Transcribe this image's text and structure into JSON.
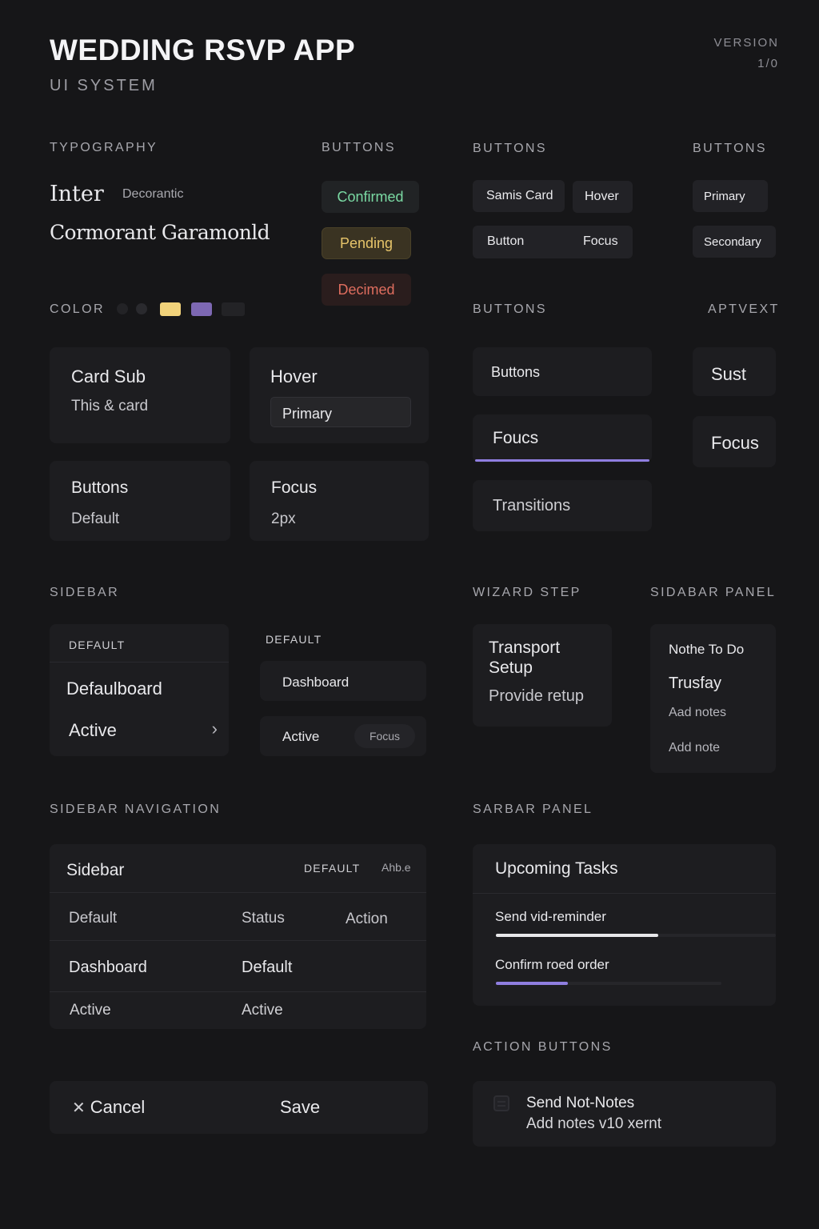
{
  "header": {
    "title": "WEDDING RSVP APP",
    "subtitle": "UI SYSTEM",
    "version_label": "VERSION",
    "version_value": "1/0"
  },
  "typography": {
    "label": "TYPOGRAPHY",
    "primary_font": "Inter",
    "primary_note": "Decorantic",
    "secondary_font": "Cormorant Garamonld"
  },
  "status_buttons": {
    "label": "BUTTONS",
    "confirmed": "Confirmed",
    "pending": "Pending",
    "declined": "Decimed",
    "colors": {
      "confirmed": "#7ad9a3",
      "pending": "#e6c46a",
      "declined": "#de6d5e"
    }
  },
  "button_chips": {
    "label": "BUTTONS",
    "samis_card": "Samis Card",
    "hover": "Hover",
    "button": "Button",
    "focus": "Focus"
  },
  "button_types": {
    "label": "BUTTONS",
    "primary": "Primary",
    "secondary": "Secondary"
  },
  "color": {
    "label": "COLOR",
    "swatches": [
      "#232326",
      "#2a2a2e",
      "#f1d27a",
      "#7d68b3",
      "#232326"
    ]
  },
  "cards": {
    "card_sub_title": "Card Sub",
    "card_sub_text": "This & card",
    "hover_title": "Hover",
    "primary_input": "Primary",
    "buttons_title": "Buttons",
    "buttons_text": "Default",
    "focus_title": "Focus",
    "focus_text": "2px"
  },
  "buttons_states": {
    "label": "BUTTONS",
    "buttons": "Buttons",
    "focus": "Foucs",
    "transitions": "Transitions",
    "focus_underline_color": "#8f7ee0"
  },
  "alt_text": {
    "label": "APTVEXT",
    "sust": "Sust",
    "focus": "Focus"
  },
  "sidebar": {
    "label": "SIDEBAR",
    "left": {
      "header": "DEFAULT",
      "item1": "Defaulboard",
      "item2": "Active"
    },
    "right": {
      "header": "DEFAULT",
      "item1": "Dashboard",
      "item2": "Active",
      "badge": "Focus"
    }
  },
  "wizard": {
    "label": "WIZARD STEP",
    "title": "Transport Setup",
    "text": "Provide retup"
  },
  "sidebar_panel": {
    "label": "SIDABAR PANEL",
    "title": "Nothe To Do",
    "item": "Trusfay",
    "note1": "Aad notes",
    "note2": "Add note"
  },
  "sidebar_nav": {
    "label": "SIDEBAR NAVIGATION",
    "title": "Sidebar",
    "header_tag": "DEFAULT",
    "header_extra": "Ahb.e",
    "columns": [
      "Default",
      "Status",
      "Action"
    ],
    "rows": [
      [
        "Dashboard",
        "Default"
      ],
      [
        "Active",
        "Active"
      ]
    ]
  },
  "tasks_panel": {
    "label": "SARBAR PANEL",
    "title": "Upcoming Tasks",
    "tasks": [
      {
        "name": "Send vid-reminder",
        "progress": 0.58,
        "color": "#e8e8ea"
      },
      {
        "name": "Confirm roed order",
        "progress": 0.3,
        "color": "#8f7ee0"
      }
    ]
  },
  "actions": {
    "cancel": "Cancel",
    "save": "Save"
  },
  "action_buttons": {
    "label": "ACTION BUTTONS",
    "line1": "Send Not-Notes",
    "line2": "Add notes v10 xernt"
  }
}
